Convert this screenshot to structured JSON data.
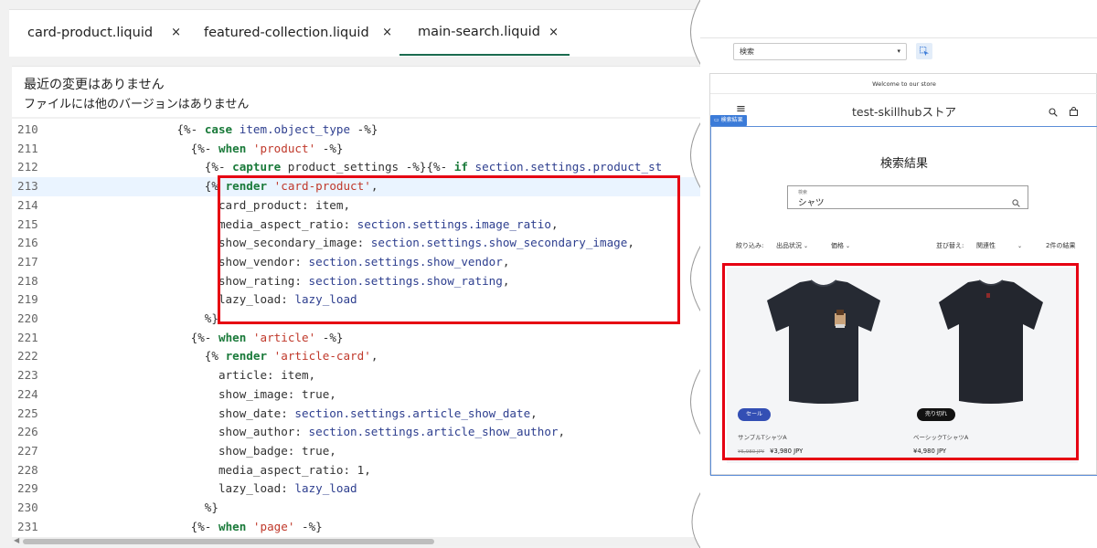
{
  "editor": {
    "tabs": [
      {
        "label": "card-product.liquid",
        "close": "×",
        "active": false
      },
      {
        "label": "featured-collection.liquid",
        "close": "×",
        "active": false
      },
      {
        "label": "main-search.liquid",
        "close": "×",
        "active": true
      }
    ],
    "history": {
      "title": "最近の変更はありません",
      "subtitle": "ファイルには他のバージョンはありません"
    },
    "highlighted_line": 213,
    "lines": [
      {
        "n": "210",
        "text": "                  {%- case item.object_type -%}"
      },
      {
        "n": "211",
        "text": "                    {%- when 'product' -%}"
      },
      {
        "n": "212",
        "text": "                      {%- capture product_settings -%}{%- if section.settings.product_st"
      },
      {
        "n": "213",
        "text": "                      {% render 'card-product',"
      },
      {
        "n": "214",
        "text": "                        card_product: item,"
      },
      {
        "n": "215",
        "text": "                        media_aspect_ratio: section.settings.image_ratio,"
      },
      {
        "n": "216",
        "text": "                        show_secondary_image: section.settings.show_secondary_image,"
      },
      {
        "n": "217",
        "text": "                        show_vendor: section.settings.show_vendor,"
      },
      {
        "n": "218",
        "text": "                        show_rating: section.settings.show_rating,"
      },
      {
        "n": "219",
        "text": "                        lazy_load: lazy_load"
      },
      {
        "n": "220",
        "text": "                      %}"
      },
      {
        "n": "221",
        "text": "                    {%- when 'article' -%}"
      },
      {
        "n": "222",
        "text": "                      {% render 'article-card',"
      },
      {
        "n": "223",
        "text": "                        article: item,"
      },
      {
        "n": "224",
        "text": "                        show_image: true,"
      },
      {
        "n": "225",
        "text": "                        show_date: section.settings.article_show_date,"
      },
      {
        "n": "226",
        "text": "                        show_author: section.settings.article_show_author,"
      },
      {
        "n": "227",
        "text": "                        show_badge: true,"
      },
      {
        "n": "228",
        "text": "                        media_aspect_ratio: 1,"
      },
      {
        "n": "229",
        "text": "                        lazy_load: lazy_load"
      },
      {
        "n": "230",
        "text": "                      %}"
      },
      {
        "n": "231",
        "text": "                    {%- when 'page' -%}"
      }
    ]
  },
  "preview": {
    "section_select": "検索",
    "select_caret": "▾",
    "announcement": "Welcome to our store",
    "brand": "test-skillhubストア",
    "section_tag": "検索結果",
    "search_title": "検索結果",
    "search_label": "検索",
    "search_value": "シャツ",
    "filters": {
      "filter_by": "絞り込み:",
      "availability": "出品状況",
      "price": "価格",
      "sort_by": "並び替え:",
      "sort_value": "関連性",
      "count": "2件の結果"
    },
    "products": [
      {
        "badge": "セール",
        "badge_color": "#334fb4",
        "name": "サンプルTシャツA",
        "old_price": "¥5,980 JPY",
        "price": "¥3,980 JPY"
      },
      {
        "badge": "売り切れ",
        "badge_color": "#121212",
        "name": "ベーシックTシャツA",
        "old_price": "",
        "price": "¥4,980 JPY"
      }
    ]
  },
  "colors": {
    "highlight_border": "#e60012",
    "keyword": "#1a7a3a",
    "string": "#c0392b",
    "property": "#2e3f8f",
    "active_tab": "#1a6b4f",
    "section_outline": "#5c8ed8"
  }
}
